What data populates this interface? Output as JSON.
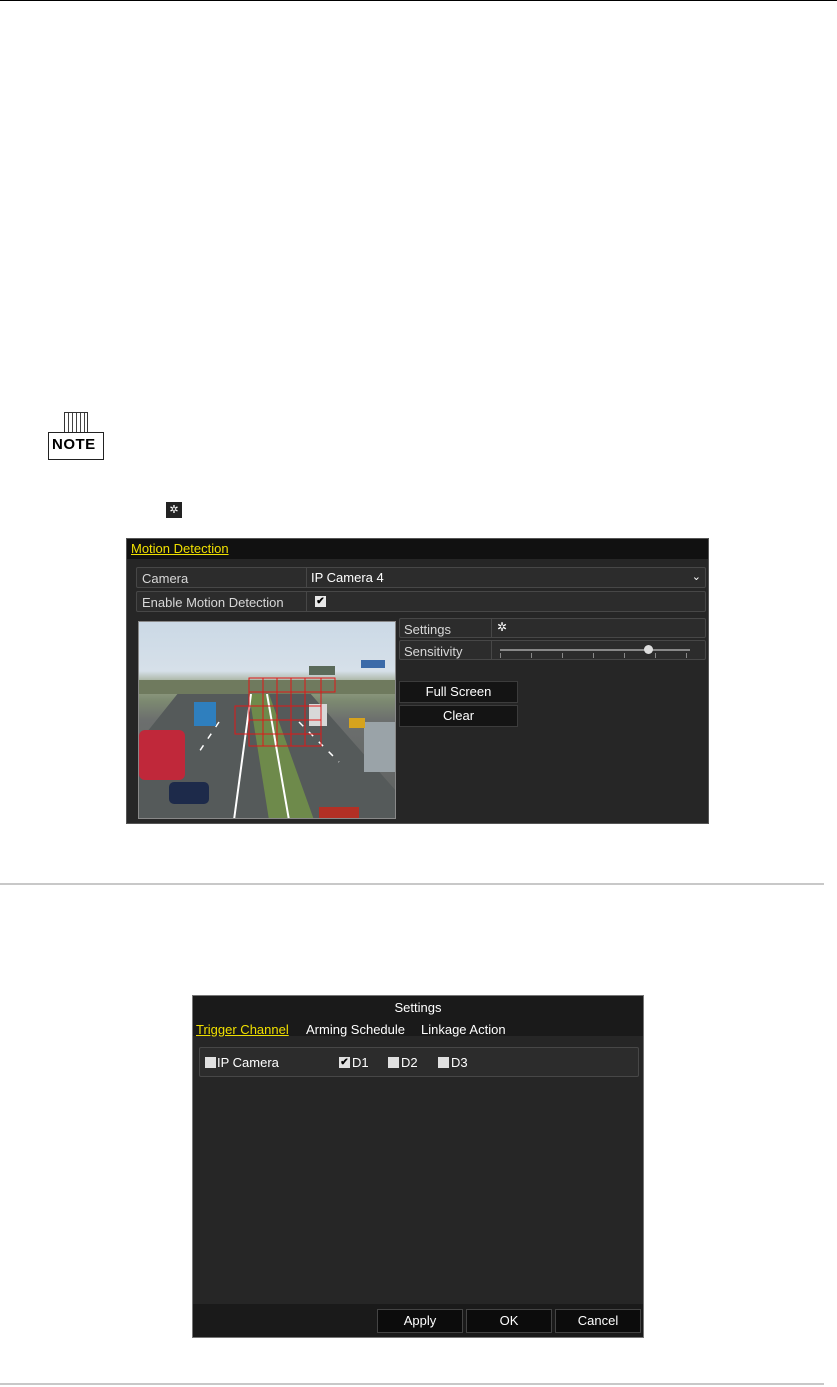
{
  "note": {
    "label": "NOTE"
  },
  "motion": {
    "title": "Motion Detection",
    "camera_label": "Camera",
    "camera_value": "IP Camera 4",
    "enable_label": "Enable Motion Detection",
    "enable_checked": "✔",
    "settings_label": "Settings",
    "sensitivity_label": "Sensitivity",
    "sensitivity_level": 0.78,
    "full_screen": "Full Screen",
    "clear": "Clear"
  },
  "settings": {
    "title": "Settings",
    "tabs": [
      "Trigger Channel",
      "Arming Schedule",
      "Linkage Action"
    ],
    "ip_camera_label": "IP Camera",
    "channels": [
      {
        "label": "D1",
        "checked": true
      },
      {
        "label": "D2",
        "checked": false
      },
      {
        "label": "D3",
        "checked": false
      }
    ],
    "buttons": {
      "apply": "Apply",
      "ok": "OK",
      "cancel": "Cancel"
    }
  }
}
